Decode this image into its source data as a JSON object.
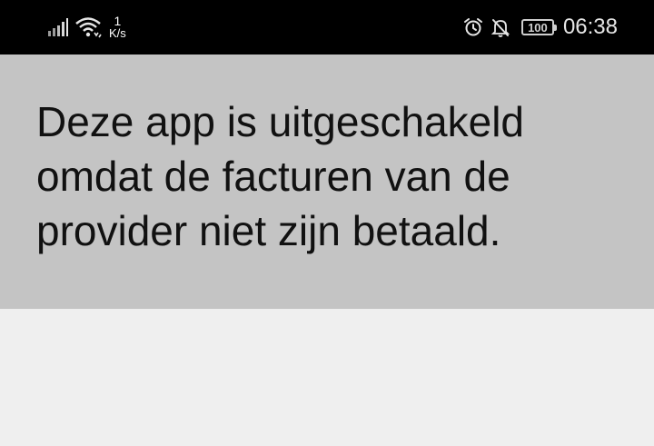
{
  "status_bar": {
    "net_speed_value": "1",
    "net_speed_unit": "K/s",
    "battery_level": "100",
    "time": "06:38",
    "icons": [
      "signal-icon",
      "wifi-icon",
      "alarm-icon",
      "bell-off-icon",
      "battery-icon"
    ]
  },
  "banner": {
    "message": "Deze app is uitgeschakeld omdat de facturen van de provider niet zijn betaald.",
    "background_color": "#c4c4c4"
  },
  "content": {
    "background_color": "#efefef"
  }
}
